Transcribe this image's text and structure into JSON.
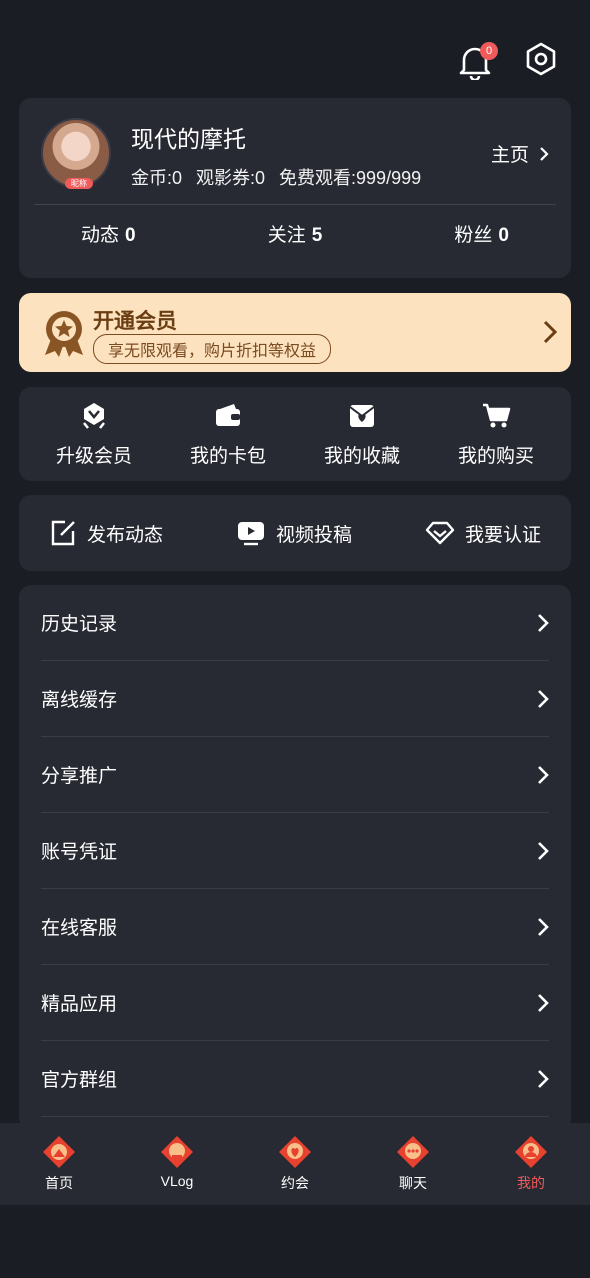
{
  "header": {
    "notification_count": "0"
  },
  "profile": {
    "username": "现代的摩托",
    "avatar_tag": "昵称",
    "coins": "金币:0",
    "tickets": "观影券:0",
    "free_watch": "免费观看:999/999",
    "homepage_label": "主页",
    "counts": [
      {
        "label": "动态",
        "value": "0"
      },
      {
        "label": "关注",
        "value": "5"
      },
      {
        "label": "粉丝",
        "value": "0"
      }
    ]
  },
  "vip": {
    "title": "开通会员",
    "subtitle": "享无限观看，购片折扣等权益"
  },
  "quick_actions": [
    {
      "label": "升级会员",
      "icon": "vip-upgrade-icon"
    },
    {
      "label": "我的卡包",
      "icon": "wallet-icon"
    },
    {
      "label": "我的收藏",
      "icon": "favorites-icon"
    },
    {
      "label": "我的购买",
      "icon": "cart-icon"
    }
  ],
  "actions": [
    {
      "label": "发布动态",
      "icon": "edit-post-icon"
    },
    {
      "label": "视频投稿",
      "icon": "video-upload-icon"
    },
    {
      "label": "我要认证",
      "icon": "diamond-icon"
    }
  ],
  "menu": [
    {
      "label": "历史记录"
    },
    {
      "label": "离线缓存"
    },
    {
      "label": "分享推广"
    },
    {
      "label": "账号凭证"
    },
    {
      "label": "在线客服"
    },
    {
      "label": "精品应用"
    },
    {
      "label": "官方群组"
    }
  ],
  "tabs": [
    {
      "label": "首页"
    },
    {
      "label": "VLog"
    },
    {
      "label": "约会"
    },
    {
      "label": "聊天"
    },
    {
      "label": "我的"
    }
  ],
  "colors": {
    "background": "#1b1d24",
    "card": "#272a33",
    "vip_bg": "#fde2bf",
    "accent_red": "#ef5a5a"
  }
}
